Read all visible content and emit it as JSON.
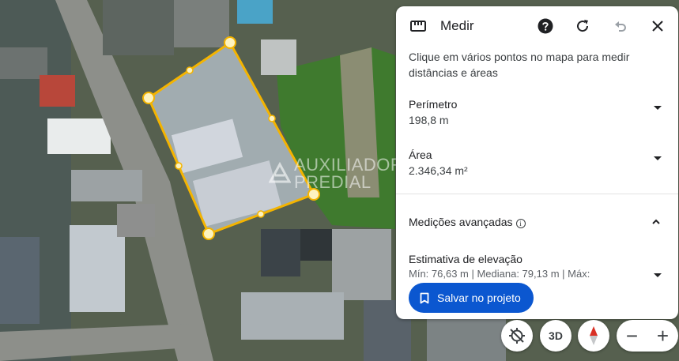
{
  "panel": {
    "title": "Medir",
    "instructions": "Clique em vários pontos no mapa para medir distâncias e áreas",
    "perimeter_label": "Perímetro",
    "perimeter_value": "198,8 m",
    "area_label": "Área",
    "area_value": "2.346,34 m²",
    "advanced_label": "Medições avançadas",
    "elevation_label": "Estimativa de elevação",
    "elevation_value": "Mín: 76,63 m | Mediana: 79,13 m | Máx:",
    "save_label": "Salvar no projeto"
  },
  "watermark": {
    "line1": "AUXILIADORA",
    "line2": "PREDIAL"
  },
  "controls": {
    "btn_3d": "3D",
    "zoom_out": "−",
    "zoom_in": "+"
  },
  "icons": {
    "ruler": "ruler-icon",
    "help": "help-icon",
    "reset": "refresh-icon",
    "undo": "undo-icon",
    "close": "close-icon",
    "info": "info-icon",
    "bookmark": "bookmark-icon",
    "locate": "location-off-icon",
    "compass": "compass-icon"
  },
  "colors": {
    "accent": "#0b57d0",
    "polygon_stroke": "#f4b400",
    "vertex_fill": "#fdf3c0"
  }
}
